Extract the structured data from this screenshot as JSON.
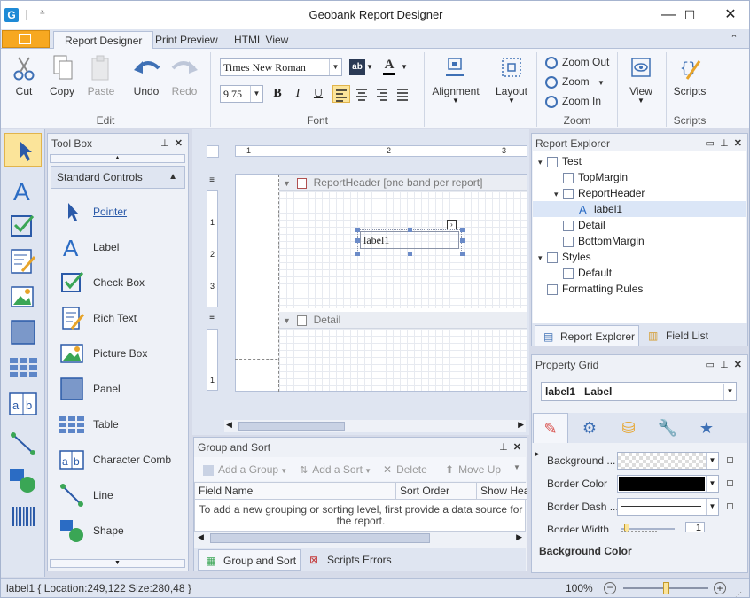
{
  "window": {
    "app_icon_letter": "G",
    "title": "Geobank Report Designer",
    "minimize": "—",
    "maximize": "☐",
    "close": "✕"
  },
  "tabs": [
    "Report Designer",
    "Print Preview",
    "HTML View"
  ],
  "ribbon": {
    "edit": {
      "cut": "Cut",
      "copy": "Copy",
      "paste": "Paste",
      "undo": "Undo",
      "redo": "Redo",
      "group": "Edit"
    },
    "font": {
      "family": "Times New Roman",
      "size": "9.75",
      "bold": "B",
      "italic": "I",
      "underline": "U",
      "group": "Font"
    },
    "alignment": {
      "label": "Alignment"
    },
    "layout": {
      "label": "Layout"
    },
    "zoom": {
      "zoom_out": "Zoom Out",
      "zoom": "Zoom",
      "zoom_in": "Zoom In",
      "group": "Zoom"
    },
    "view": {
      "label": "View"
    },
    "scripts": {
      "label": "Scripts",
      "group": "Scripts"
    }
  },
  "toolbox": {
    "title": "Tool Box",
    "section": "Standard Controls",
    "items": [
      "Pointer",
      "Label",
      "Check Box",
      "Rich Text",
      "Picture Box",
      "Panel",
      "Table",
      "Character Comb",
      "Line",
      "Shape"
    ]
  },
  "design": {
    "ruler_ticks": [
      "1",
      "2",
      "3"
    ],
    "report_header_band": "ReportHeader [one band per report]",
    "detail_band": "Detail",
    "label_text": "label1",
    "vruler_header": [
      "1",
      "2",
      "3"
    ],
    "vruler_detail": [
      "1"
    ]
  },
  "group_sort": {
    "title": "Group and Sort",
    "add_group": "Add a Group",
    "add_sort": "Add a Sort",
    "delete": "Delete",
    "move_up": "Move Up",
    "columns": [
      "Field Name",
      "Sort Order",
      "Show Hea"
    ],
    "note": "To add a new grouping or sorting level, first provide a data source for the report.",
    "tab_group_sort": "Group and Sort",
    "tab_scripts_errors": "Scripts Errors"
  },
  "report_explorer": {
    "title": "Report Explorer",
    "tree": [
      {
        "label": "Test",
        "level": 0,
        "expander": "▾"
      },
      {
        "label": "TopMargin",
        "level": 1,
        "expander": ""
      },
      {
        "label": "ReportHeader",
        "level": 1,
        "expander": "▾"
      },
      {
        "label": "label1",
        "level": 2,
        "expander": "",
        "selected": true
      },
      {
        "label": "Detail",
        "level": 1,
        "expander": ""
      },
      {
        "label": "BottomMargin",
        "level": 1,
        "expander": ""
      },
      {
        "label": "Styles",
        "level": 0,
        "expander": "▾"
      },
      {
        "label": "Default",
        "level": 1,
        "expander": ""
      },
      {
        "label": "Formatting Rules",
        "level": 0,
        "expander": ""
      }
    ],
    "tab_explorer": "Report Explorer",
    "tab_field_list": "Field List"
  },
  "property_grid": {
    "title": "Property Grid",
    "selected_object": "label1   Label",
    "rows": [
      {
        "name": "Background ...",
        "value": ""
      },
      {
        "name": "Border Color",
        "value": ""
      },
      {
        "name": "Border Dash ...",
        "value": ""
      },
      {
        "name": "Border Width",
        "value": "1"
      }
    ],
    "description_title": "Background Color"
  },
  "status": {
    "text": "label1 { Location:249,122 Size:280,48 }",
    "zoom": "100%",
    "zoom_level_fraction": 0.47
  },
  "colors": {
    "accent_blue": "#3e70b5",
    "file_tab_orange": "#f7a821",
    "selection_yellow": "#fbe49a"
  }
}
